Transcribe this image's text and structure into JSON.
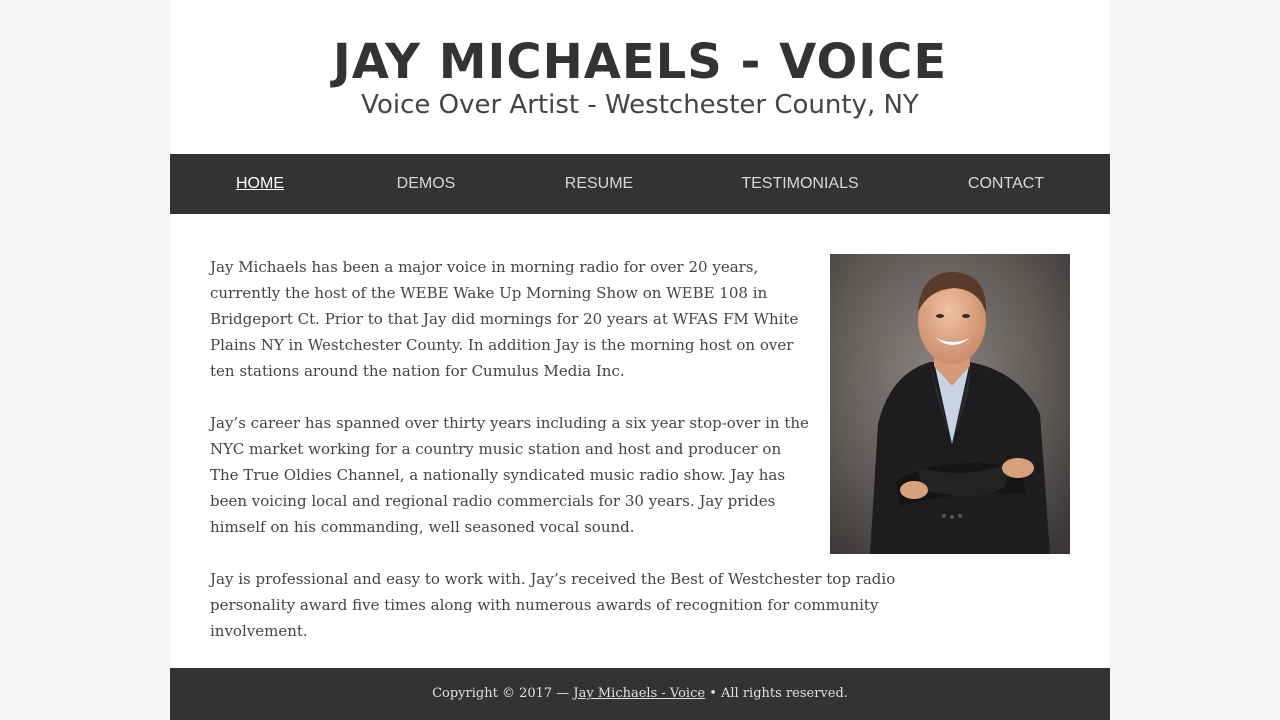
{
  "header": {
    "title": "JAY MICHAELS - VOICE",
    "tagline": "Voice Over Artist - Westchester County, NY"
  },
  "nav": {
    "items": [
      {
        "label": "HOME",
        "active": true
      },
      {
        "label": "DEMOS"
      },
      {
        "label": "RESUME"
      },
      {
        "label": "TESTIMONIALS"
      },
      {
        "label": "CONTACT"
      }
    ]
  },
  "main": {
    "paragraphs": [
      "Jay Michaels has been a major voice in morning radio for over 20 years, currently the host of the WEBE Wake Up Morning Show on WEBE 108 in Bridgeport Ct. Prior to that Jay did mornings for 20 years at WFAS FM White Plains NY in Westchester County. In addition Jay is the morning host on over ten stations around the nation for Cumulus Media Inc.",
      "Jay’s career has spanned over thirty years including a six year stop-over in the NYC market working for a country music station and host and producer on The True Oldies Channel, a nationally syndicated music radio show.  Jay has been voicing local and regional  radio commercials for 30 years. Jay prides himself on his commanding,  well seasoned vocal sound.",
      "Jay is professional and easy to work with. Jay’s received the Best of Westchester top radio personality award five times along with numerous awards of recognition for community involvement."
    ]
  },
  "footer": {
    "prefix": "Copyright © 2017 — ",
    "site_link": "Jay Michaels - Voice",
    "suffix": " • All rights reserved."
  },
  "colors": {
    "nav_bg": "#333333",
    "page_bg": "#f5f5f5",
    "text": "#444444"
  }
}
